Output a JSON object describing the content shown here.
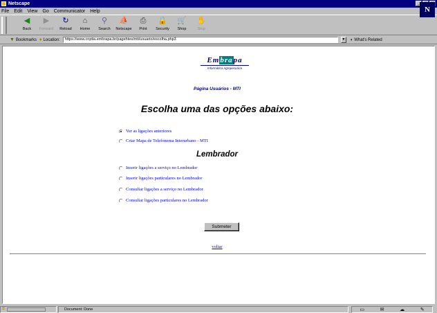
{
  "window": {
    "title": "Netscape"
  },
  "menu": [
    "File",
    "Edit",
    "View",
    "Go",
    "Communicator",
    "Help"
  ],
  "toolbar": [
    {
      "label": "Back",
      "icon": "back-arrow-icon",
      "glyph": "◀",
      "color": "#208020",
      "disabled": false
    },
    {
      "label": "Forward",
      "icon": "forward-arrow-icon",
      "glyph": "▶",
      "color": "#909090",
      "disabled": true
    },
    {
      "label": "Reload",
      "icon": "reload-icon",
      "glyph": "↻",
      "color": "#000080",
      "disabled": false
    },
    {
      "label": "Home",
      "icon": "home-icon",
      "glyph": "⌂",
      "color": "#404040",
      "disabled": false
    },
    {
      "label": "Search",
      "icon": "search-icon",
      "glyph": "⚲",
      "color": "#6060a0",
      "disabled": false
    },
    {
      "label": "Netscape",
      "icon": "netscape-icon",
      "glyph": "⛵",
      "color": "#206060",
      "disabled": false
    },
    {
      "label": "Print",
      "icon": "print-icon",
      "glyph": "⎙",
      "color": "#404040",
      "disabled": false
    },
    {
      "label": "Security",
      "icon": "lock-icon",
      "glyph": "🔒",
      "color": "#808000",
      "disabled": false
    },
    {
      "label": "Shop",
      "icon": "shop-icon",
      "glyph": "🛒",
      "color": "#404080",
      "disabled": false
    },
    {
      "label": "Stop",
      "icon": "stop-icon",
      "glyph": "✋",
      "color": "#909090",
      "disabled": true
    }
  ],
  "location": {
    "bookmarks_label": "Bookmarks",
    "location_label": "Location:",
    "url": "https://www.cnptia.embrapa.br/pagehtes/mti/usuario/escolha.php3",
    "whats_related": "What's Related"
  },
  "page": {
    "logo_main_left": "Em",
    "logo_main_mid": "bra",
    "logo_main_right": "pa",
    "logo_sub": "Informática Agropecuária",
    "subtitle": "Página Usuários - MTI",
    "heading": "Escolha uma das opções abaixo:",
    "options_group1": [
      {
        "label": "Ver as ligações anteriores",
        "selected": true
      },
      {
        "label": "Criar Mapa de Telefonema Interurbano - MTI",
        "selected": false
      }
    ],
    "heading2": "Lembrador",
    "options_group2": [
      {
        "label": "Inserir ligações a serviço no Lembrador",
        "selected": false
      },
      {
        "label": "Inserir ligações particulares no Lembrador",
        "selected": false
      },
      {
        "label": "Consultar ligações a serviço no Lembrador",
        "selected": false
      },
      {
        "label": "Consultar ligações particulares no Lembrador",
        "selected": false
      }
    ],
    "submit_label": "Submeter",
    "back_link": "voltar"
  },
  "status": {
    "text": "Document: Done",
    "icons": [
      "component-bar-icon",
      "mail-icon",
      "discussion-icon",
      "composer-icon"
    ]
  }
}
